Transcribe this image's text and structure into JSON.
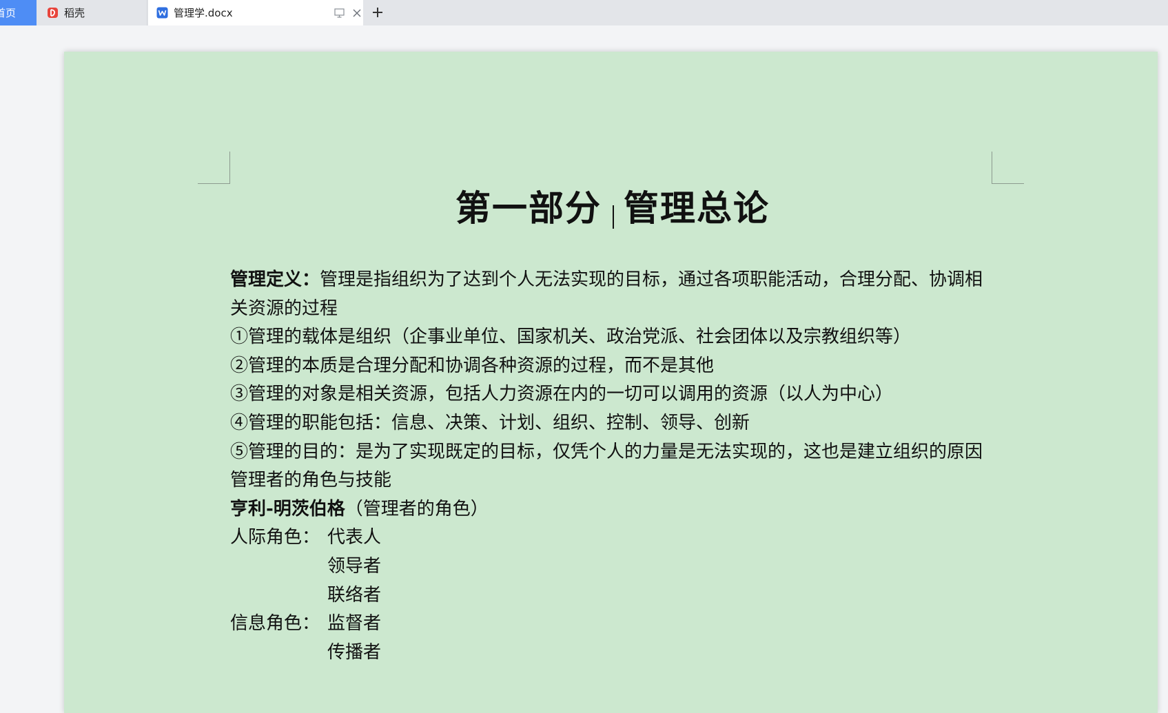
{
  "tabs": {
    "home": {
      "label": "首页"
    },
    "daoke": {
      "label": "稻壳"
    },
    "document": {
      "label": "管理学.docx"
    }
  },
  "colors": {
    "page_background": "#cce8cf",
    "tab_active_home": "#4e8df5",
    "daoke_icon": "#e8453c",
    "wps_icon": "#2f6fe0"
  },
  "icons": {
    "daoke": "daoke-logo-icon",
    "document": "wps-writer-icon",
    "monitor": "monitor-icon",
    "close": "close-icon",
    "new_tab": "plus-icon"
  },
  "document": {
    "title_part1": "第一部分",
    "title_part2": "管理总论",
    "definition_label": "管理定义：",
    "definition_text": "管理是指组织为了达到个人无法实现的目标，通过各项职能活动，合理分配、协调相关资源的过程",
    "point1": "①管理的载体是组织（企事业单位、国家机关、政治党派、社会团体以及宗教组织等）",
    "point2": "②管理的本质是合理分配和协调各种资源的过程，而不是其他",
    "point3": "③管理的对象是相关资源，包括人力资源在内的一切可以调用的资源（以人为中心）",
    "point4": "④管理的职能包括：信息、决策、计划、组织、控制、领导、创新",
    "point5": "⑤管理的目的：是为了实现既定的目标，仅凭个人的力量是无法实现的，这也是建立组织的原因",
    "section_heading": "管理者的角色与技能",
    "mintzberg_bold": "亨利-明茨伯格",
    "mintzberg_rest": "（管理者的角色）",
    "interpersonal_label": "人际角色：",
    "interpersonal_roles": [
      "代表人",
      "领导者",
      "联络者"
    ],
    "informational_label": "信息角色：",
    "informational_roles": [
      "监督者",
      "传播者"
    ]
  }
}
